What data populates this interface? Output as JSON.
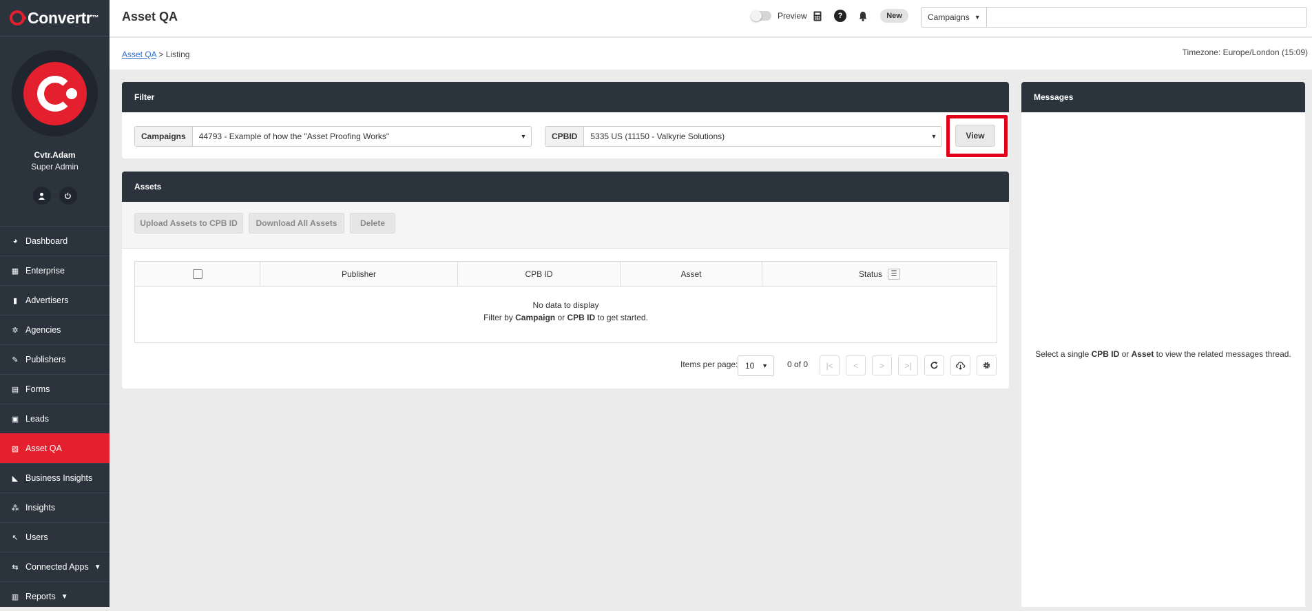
{
  "app": {
    "logo": "Convertr",
    "logo_tm": "™"
  },
  "user": {
    "name": "Cvtr.Adam",
    "role": "Super Admin"
  },
  "nav": {
    "items": [
      {
        "label": "Dashboard",
        "icon": "dashboard-icon"
      },
      {
        "label": "Enterprise",
        "icon": "building-icon"
      },
      {
        "label": "Advertisers",
        "icon": "advertisers-icon"
      },
      {
        "label": "Agencies",
        "icon": "agencies-icon"
      },
      {
        "label": "Publishers",
        "icon": "publishers-icon"
      },
      {
        "label": "Forms",
        "icon": "forms-icon"
      },
      {
        "label": "Leads",
        "icon": "leads-icon"
      },
      {
        "label": "Asset QA",
        "icon": "asset-qa-icon",
        "active": true
      },
      {
        "label": "Business Insights",
        "icon": "chart-icon"
      },
      {
        "label": "Insights",
        "icon": "insights-icon"
      },
      {
        "label": "Users",
        "icon": "users-icon"
      },
      {
        "label": "Connected Apps",
        "icon": "connected-apps-icon",
        "expandable": true
      },
      {
        "label": "Reports",
        "icon": "reports-icon",
        "expandable": true
      }
    ]
  },
  "header": {
    "title": "Asset QA",
    "preview_label": "Preview",
    "new_badge": "New",
    "search_scope": "Campaigns",
    "search_placeholder": ""
  },
  "breadcrumb": {
    "root": "Asset QA",
    "separator": ">",
    "current": "Listing"
  },
  "timezone": "Timezone: Europe/London (15:09)",
  "filter": {
    "title": "Filter",
    "campaigns_label": "Campaigns",
    "campaigns_value": "44793 - Example of how the \"Asset Proofing Works\"",
    "cpbid_label": "CPBID",
    "cpbid_value": "5335 US (11150 - Valkyrie Solutions)",
    "view_button": "View"
  },
  "assets": {
    "title": "Assets",
    "upload_button": "Upload Assets to CPB ID",
    "download_button": "Download All Assets",
    "delete_button": "Delete",
    "columns": [
      "Publisher",
      "CPB ID",
      "Asset",
      "Status"
    ],
    "empty_line1": "No data to display",
    "empty_line2": {
      "prefix": "Filter by",
      "campaign": "Campaign",
      "or": "or",
      "cpbid": "CPB ID",
      "suffix": "to get started."
    },
    "pagination": {
      "items_per_page_label": "Items per page:",
      "items_per_page": "10",
      "range": "0 of 0"
    }
  },
  "messages": {
    "title": "Messages",
    "hint": {
      "prefix": "Select a single",
      "cpbid": "CPB ID",
      "or": "or",
      "asset": "Asset",
      "suffix": "to view the related messages thread."
    }
  },
  "colors": {
    "accent": "#e5202e",
    "sidebar": "#2b343d",
    "highlight": "#e5001a",
    "link": "#2b6fd6"
  }
}
